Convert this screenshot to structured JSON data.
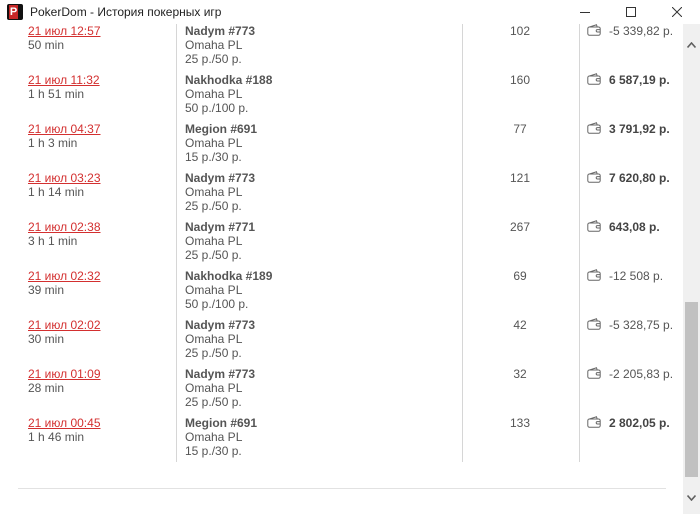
{
  "window": {
    "title": "PokerDom - История покерных игр",
    "app_icon_letter": "P"
  },
  "rows": [
    {
      "date": "21 июл 12:57",
      "duration": "50 min",
      "table": "Nadym #773",
      "game": "Omaha PL",
      "stakes": "25 р./50 р.",
      "hands": "102",
      "result": "-5 339,82 р.",
      "positive": false
    },
    {
      "date": "21 июл 11:32",
      "duration": "1 h 51 min",
      "table": "Nakhodka #188",
      "game": "Omaha PL",
      "stakes": "50 р./100 р.",
      "hands": "160",
      "result": "6 587,19 р.",
      "positive": true
    },
    {
      "date": "21 июл 04:37",
      "duration": "1 h 3 min",
      "table": "Megion #691",
      "game": "Omaha PL",
      "stakes": "15 р./30 р.",
      "hands": "77",
      "result": "3 791,92 р.",
      "positive": true
    },
    {
      "date": "21 июл 03:23",
      "duration": "1 h 14 min",
      "table": "Nadym #773",
      "game": "Omaha PL",
      "stakes": "25 р./50 р.",
      "hands": "121",
      "result": "7 620,80 р.",
      "positive": true
    },
    {
      "date": "21 июл 02:38",
      "duration": "3 h 1 min",
      "table": "Nadym #771",
      "game": "Omaha PL",
      "stakes": "25 р./50 р.",
      "hands": "267",
      "result": "643,08 р.",
      "positive": true
    },
    {
      "date": "21 июл 02:32",
      "duration": "39 min",
      "table": "Nakhodka #189",
      "game": "Omaha PL",
      "stakes": "50 р./100 р.",
      "hands": "69",
      "result": "-12 508 р.",
      "positive": false
    },
    {
      "date": "21 июл 02:02",
      "duration": "30 min",
      "table": "Nadym #773",
      "game": "Omaha PL",
      "stakes": "25 р./50 р.",
      "hands": "42",
      "result": "-5 328,75 р.",
      "positive": false
    },
    {
      "date": "21 июл 01:09",
      "duration": "28 min",
      "table": "Nadym #773",
      "game": "Omaha PL",
      "stakes": "25 р./50 р.",
      "hands": "32",
      "result": "-2 205,83 р.",
      "positive": false
    },
    {
      "date": "21 июл 00:45",
      "duration": "1 h 46 min",
      "table": "Megion #691",
      "game": "Omaha PL",
      "stakes": "15 р./30 р.",
      "hands": "133",
      "result": "2 802,05 р.",
      "positive": true
    }
  ],
  "icons": {
    "wallet": "wallet-icon",
    "minimize": "minimize-icon",
    "maximize": "maximize-icon",
    "close": "close-icon",
    "scroll_up": "chevron-up-icon",
    "scroll_down": "chevron-down-icon"
  }
}
